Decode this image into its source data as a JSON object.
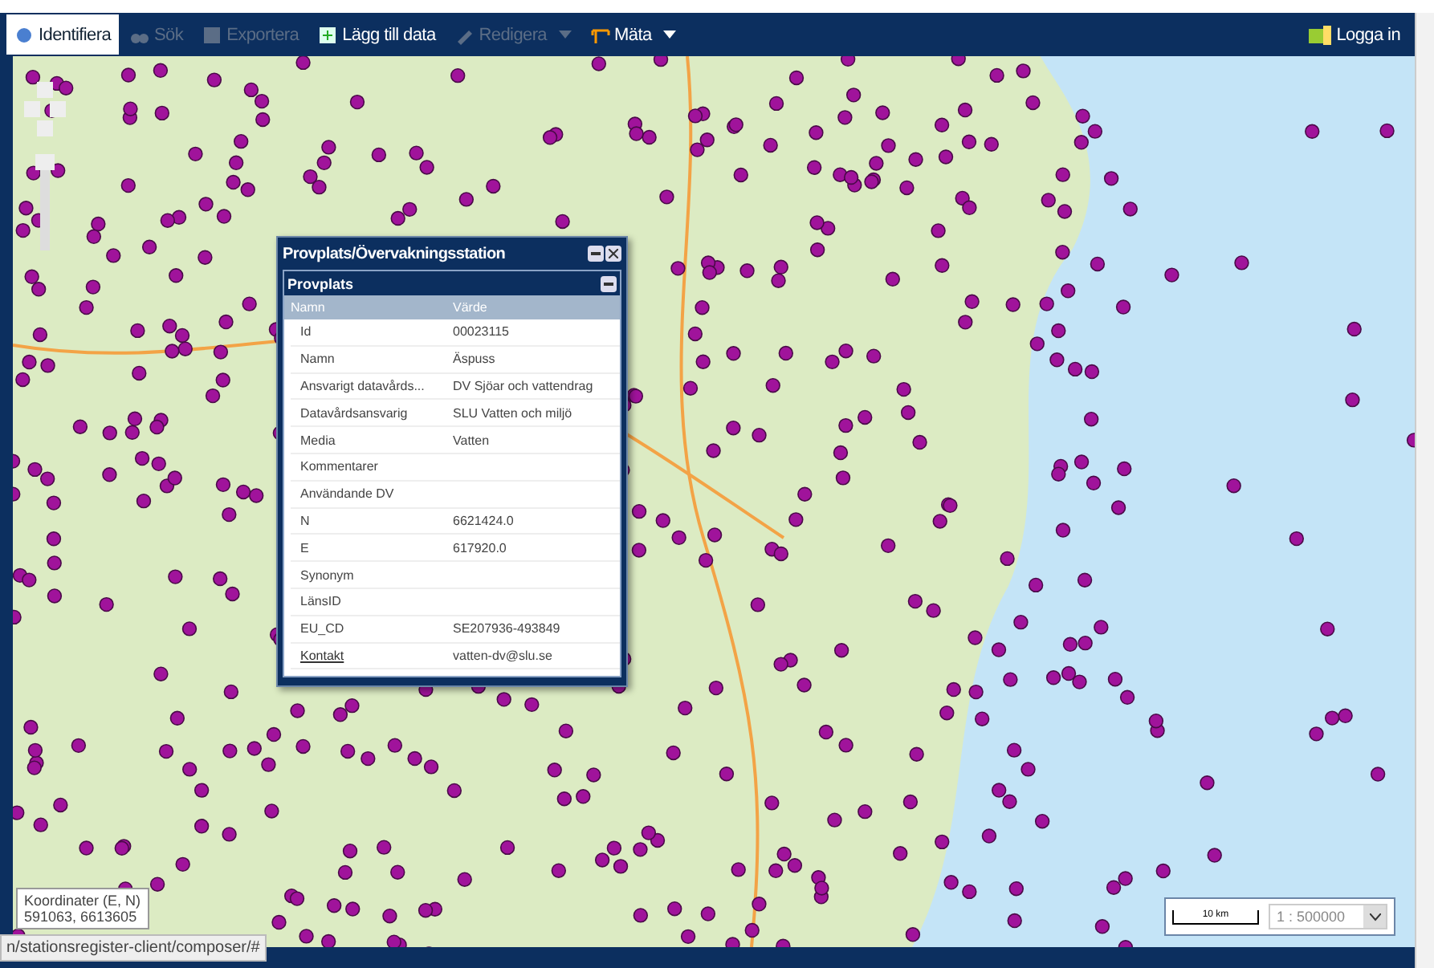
{
  "toolbar": {
    "items": [
      {
        "label": "Identifiera",
        "disabled": false,
        "selected": true,
        "dropdown": false
      },
      {
        "label": "Sök",
        "disabled": true,
        "selected": false,
        "dropdown": false
      },
      {
        "label": "Exportera",
        "disabled": true,
        "selected": false,
        "dropdown": false
      },
      {
        "label": "Lägg till data",
        "disabled": false,
        "selected": false,
        "dropdown": false
      },
      {
        "label": "Redigera",
        "disabled": true,
        "selected": false,
        "dropdown": true
      },
      {
        "label": "Mäta",
        "disabled": false,
        "selected": false,
        "dropdown": true
      }
    ],
    "login": "Logga in"
  },
  "popup": {
    "title": "Provplats/Övervakningsstation",
    "section": "Provplats",
    "columns": [
      "Namn",
      "Värde"
    ],
    "rows": [
      {
        "name": "Id",
        "value": "00023115",
        "kind": "text"
      },
      {
        "name": "Namn",
        "value": "Äspuss",
        "kind": "text"
      },
      {
        "name": "Ansvarigt datavårds...",
        "value": "DV Sjöar och vattendrag",
        "kind": "text"
      },
      {
        "name": "Datavårdsansvarig",
        "value": "SLU Vatten och miljö",
        "kind": "text"
      },
      {
        "name": "Media",
        "value": "Vatten",
        "kind": "text"
      },
      {
        "name": "Kommentarer",
        "kind": "text"
      },
      {
        "name": "Användande DV",
        "kind": "text"
      },
      {
        "name": "N",
        "value": "6621424.0",
        "kind": "text"
      },
      {
        "name": "E",
        "value": "617920.0",
        "kind": "text"
      },
      {
        "name": "Synonym",
        "kind": "text"
      },
      {
        "name": "LänsID",
        "kind": "text"
      },
      {
        "name": "EU_CD",
        "value": "SE207936-493849",
        "kind": "text"
      },
      {
        "name": "Kontakt",
        "value": "vatten-dv@slu.se",
        "kind": "link"
      }
    ]
  },
  "coordinates": {
    "label": "Koordinater (E, N)",
    "value": "591063, 6613605"
  },
  "scale": {
    "bar_label": "10 km",
    "value": "1 : 500000"
  },
  "status_url": "n/stationsregister-client/composer/#"
}
